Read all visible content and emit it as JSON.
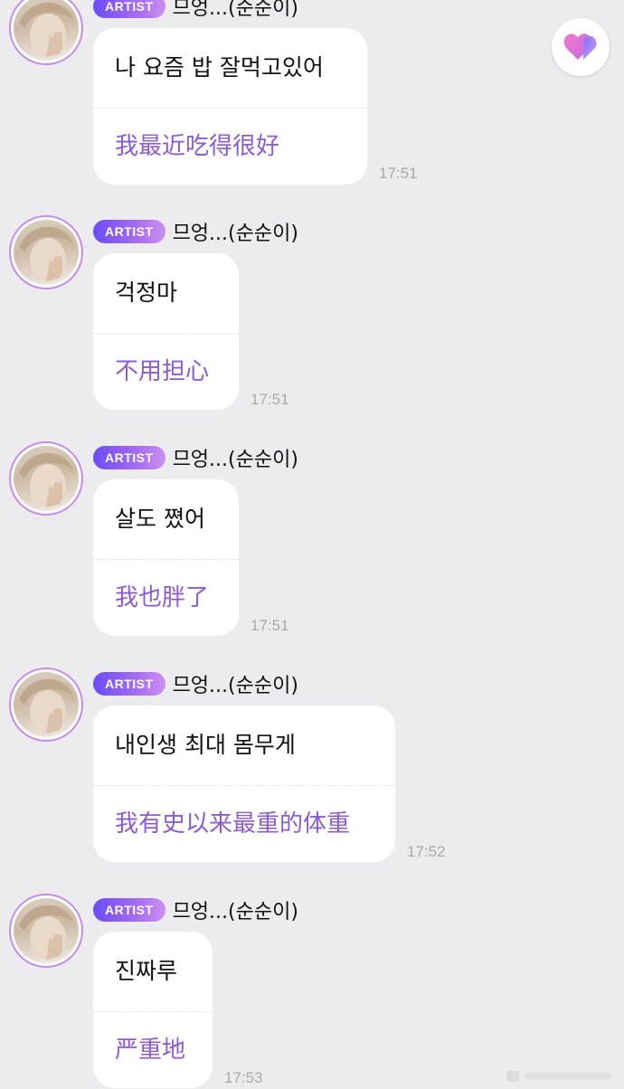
{
  "messages": [
    {
      "badge": "ARTIST",
      "sender": "므엉...(순순이)",
      "korean": "나 요즘 밥 잘먹고있어",
      "chinese": "我最近吃得很好",
      "time": "17:51"
    },
    {
      "badge": "ARTIST",
      "sender": "므엉...(순순이)",
      "korean": "걱정마",
      "chinese": "不用担心",
      "time": "17:51"
    },
    {
      "badge": "ARTIST",
      "sender": "므엉...(순순이)",
      "korean": "살도 쪘어",
      "chinese": "我也胖了",
      "time": "17:51"
    },
    {
      "badge": "ARTIST",
      "sender": "므엉...(순순이)",
      "korean": "내인생 최대 몸무게",
      "chinese": "我有史以来最重的体重",
      "time": "17:52"
    },
    {
      "badge": "ARTIST",
      "sender": "므엉...(순순이)",
      "korean": "진짜루",
      "chinese": "严重地",
      "time": "17:53"
    }
  ],
  "icons": {
    "heart_button": "heart-icon"
  },
  "colors": {
    "background": "#ececef",
    "bubble": "#ffffff",
    "translation_text": "#8c5bd0",
    "badge_start": "#6a4cf5",
    "badge_end": "#cc8ff2",
    "timestamp": "#a9a9ae"
  }
}
